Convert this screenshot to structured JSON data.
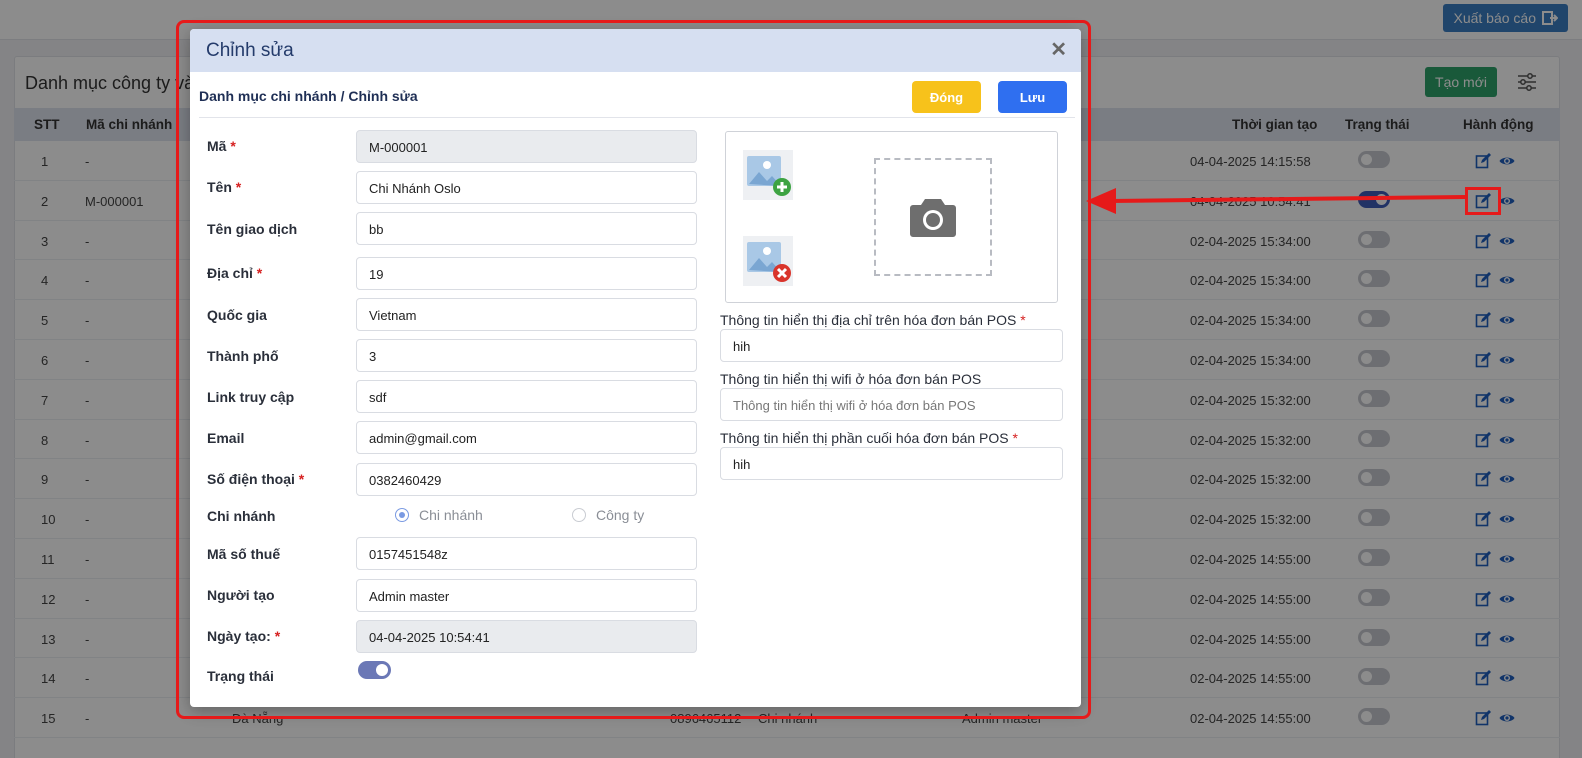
{
  "header": {
    "export_label": "Xuất báo cáo"
  },
  "page": {
    "title": "Danh mục công ty và chi nhánh",
    "create_label": "Tạo mới"
  },
  "table": {
    "columns": {
      "stt": "STT",
      "code": "Mã chi nhánh",
      "created_time": "Thời gian tạo",
      "status": "Trạng thái",
      "actions": "Hành động"
    },
    "rows": [
      {
        "stt": "1",
        "code": "-",
        "time": "04-04-2025 14:15:58",
        "on": false
      },
      {
        "stt": "2",
        "code": "M-000001",
        "time": "04-04-2025 10:54:41",
        "on": true
      },
      {
        "stt": "3",
        "code": "-",
        "time": "02-04-2025 15:34:00",
        "on": false
      },
      {
        "stt": "4",
        "code": "-",
        "time": "02-04-2025 15:34:00",
        "on": false
      },
      {
        "stt": "5",
        "code": "-",
        "time": "02-04-2025 15:34:00",
        "on": false
      },
      {
        "stt": "6",
        "code": "-",
        "time": "02-04-2025 15:34:00",
        "on": false
      },
      {
        "stt": "7",
        "code": "-",
        "time": "02-04-2025 15:32:00",
        "on": false
      },
      {
        "stt": "8",
        "code": "-",
        "time": "02-04-2025 15:32:00",
        "on": false
      },
      {
        "stt": "9",
        "code": "-",
        "time": "02-04-2025 15:32:00",
        "on": false
      },
      {
        "stt": "10",
        "code": "-",
        "time": "02-04-2025 15:32:00",
        "on": false
      },
      {
        "stt": "11",
        "code": "-",
        "time": "02-04-2025 14:55:00",
        "on": false
      },
      {
        "stt": "12",
        "code": "-",
        "time": "02-04-2025 14:55:00",
        "on": false
      },
      {
        "stt": "13",
        "code": "-",
        "time": "02-04-2025 14:55:00",
        "on": false
      },
      {
        "stt": "14",
        "code": "-",
        "time": "02-04-2025 14:55:00",
        "on": false
      },
      {
        "stt": "15",
        "code": "-",
        "time": "02-04-2025 14:55:00",
        "on": false
      }
    ],
    "row15_extra": {
      "city": "Đà Nẵng",
      "phone": "0896465112",
      "type": "Chi nhánh",
      "creator": "Admin master"
    }
  },
  "modal": {
    "title": "Chỉnh sửa",
    "breadcrumb": "Danh mục chi nhánh / Chỉnh sửa",
    "close_label": "Đóng",
    "save_label": "Lưu",
    "fields": {
      "code": {
        "label": "Mã",
        "value": "M-000001"
      },
      "name": {
        "label": "Tên",
        "value": "Chi Nhánh Oslo"
      },
      "trade_name": {
        "label": "Tên giao dịch",
        "value": "bb"
      },
      "address": {
        "label": "Địa chỉ",
        "value": "19"
      },
      "country": {
        "label": "Quốc gia",
        "value": "Vietnam"
      },
      "city": {
        "label": "Thành phố",
        "value": "3"
      },
      "link": {
        "label": "Link truy cập",
        "value": "sdf"
      },
      "email": {
        "label": "Email",
        "value": "admin@gmail.com"
      },
      "phone": {
        "label": "Số điện thoại",
        "value": "0382460429"
      },
      "branch": {
        "label": "Chi nhánh",
        "option_branch": "Chi nhánh",
        "option_company": "Công ty",
        "selected": "Chi nhánh"
      },
      "tax_code": {
        "label": "Mã số thuế",
        "value": "0157451548z"
      },
      "creator": {
        "label": "Người tạo",
        "value": "Admin master"
      },
      "created_date": {
        "label": "Ngày tạo:",
        "value": "04-04-2025 10:54:41"
      },
      "status": {
        "label": "Trạng thái",
        "on": true
      }
    },
    "pos": {
      "address_label": "Thông tin hiển thị địa chỉ trên hóa đơn bán POS",
      "address_value": "hih",
      "wifi_label": "Thông tin hiển thị wifi ở hóa đơn bán POS",
      "wifi_placeholder": "Thông tin hiển thị wifi ở hóa đơn bán POS",
      "footer_label": "Thông tin hiển thị phần cuối hóa đơn bán POS",
      "footer_value": "hih"
    }
  },
  "colors": {
    "primary": "#2f6ff0",
    "warning": "#f7c21b",
    "success": "#2fa36b",
    "annotation": "#e61a1a"
  }
}
